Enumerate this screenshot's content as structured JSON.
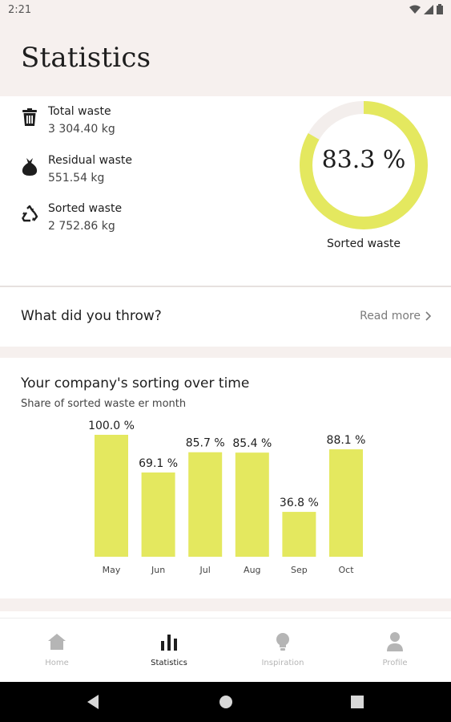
{
  "status_bar": {
    "time": "2:21",
    "icons": [
      "wifi-icon",
      "signal-icon",
      "battery-icon"
    ]
  },
  "header": {
    "title": "Statistics"
  },
  "waste": {
    "items": [
      {
        "label": "Total waste",
        "value": "3 304.40 kg",
        "icon": "trash-bin-icon"
      },
      {
        "label": "Residual waste",
        "value": "551.54 kg",
        "icon": "garbage-bag-icon"
      },
      {
        "label": "Sorted waste",
        "value": "2 752.86 kg",
        "icon": "recycle-icon"
      }
    ],
    "donut": {
      "value_text": "83.3 %",
      "fraction": 0.833,
      "caption": "Sorted waste",
      "color": "#e4e85f",
      "track_color": "#f3eeec"
    }
  },
  "throw": {
    "question": "What did you throw?",
    "read_more": "Read more"
  },
  "sorting": {
    "title": "Your company's sorting over time",
    "subtitle": "Share of sorted waste er month"
  },
  "chart_data": {
    "type": "bar",
    "categories": [
      "May",
      "Jun",
      "Jul",
      "Aug",
      "Sep",
      "Oct"
    ],
    "values": [
      100.0,
      69.1,
      85.7,
      85.4,
      36.8,
      88.1
    ],
    "value_labels": [
      "100.0 %",
      "69.1 %",
      "85.7 %",
      "85.4 %",
      "36.8 %",
      "88.1 %"
    ],
    "ylim": [
      0,
      100
    ],
    "bar_color": "#e4e85f",
    "grid": false
  },
  "bottom_nav": {
    "items": [
      {
        "label": "Home",
        "icon": "home-icon",
        "active": false
      },
      {
        "label": "Statistics",
        "icon": "bar-chart-icon",
        "active": true
      },
      {
        "label": "Inspiration",
        "icon": "lightbulb-icon",
        "active": false
      },
      {
        "label": "Profile",
        "icon": "profile-icon",
        "active": false
      }
    ]
  },
  "system_nav": {
    "icons": [
      "back-icon",
      "home-circle-icon",
      "recents-icon"
    ]
  },
  "colors": {
    "background": "#f6f0ee",
    "accent": "#e4e85f",
    "card": "#ffffff"
  }
}
